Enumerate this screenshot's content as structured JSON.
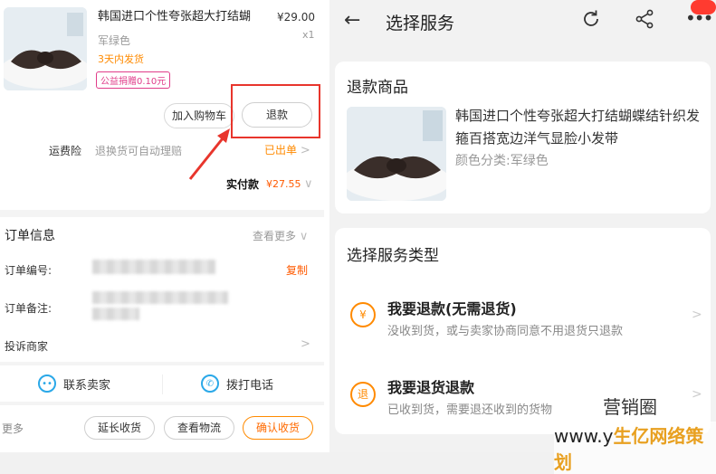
{
  "left": {
    "product_title": "韩国进口个性夸张超大打结蝴",
    "price": "¥29.00",
    "qty": "x1",
    "color": "军绿色",
    "shipping": "3天内发货",
    "charity": "公益捐赠0.10元",
    "buttons": {
      "add_cart": "加入购物车",
      "refund": "退款"
    },
    "insurance": {
      "label": "运费险",
      "desc": "退换货可自动理赔",
      "status": "已出单",
      "chevron": ">"
    },
    "paid": {
      "label": "实付款",
      "amount": "¥27.55",
      "chevron": "∨"
    },
    "order_info": {
      "title": "订单信息",
      "more": "查看更多",
      "more_chevron": "∨",
      "order_no_label": "订单编号:",
      "copy": "复制",
      "note_label": "订单备注:",
      "complain_label": "投诉商家",
      "complain_chevron": ">"
    },
    "contact": {
      "seller": "联系卖家",
      "call": "拨打电话"
    },
    "bottom": {
      "more": "更多",
      "extend": "延长收货",
      "logistics": "查看物流",
      "confirm": "确认收货"
    }
  },
  "right": {
    "header": {
      "back": "←",
      "title": "选择服务",
      "menu": "•••"
    },
    "product_card": {
      "title": "退款商品",
      "product_name": "韩国进口个性夸张超大打结蝴蝶结针织发箍百搭宽边洋气显脸小发带",
      "color": "颜色分类:军绿色"
    },
    "service_card": {
      "title": "选择服务类型",
      "options": [
        {
          "icon": "¥",
          "title": "我要退款(无需退货)",
          "desc": "没收到货，或与卖家协商同意不用退货只退款",
          "chevron": ">"
        },
        {
          "icon": "退",
          "title": "我要退货退款",
          "desc": "已收到货，需要退还收到的货物",
          "chevron": ">"
        }
      ]
    }
  },
  "watermark": {
    "line1": "营销圈",
    "line2_prefix": "www.y",
    "line2_brand": "生亿网络策划"
  },
  "colors": {
    "accent_orange": "#ff8a00",
    "highlight_red": "#e8352c",
    "price_orange": "#ff5a00"
  }
}
